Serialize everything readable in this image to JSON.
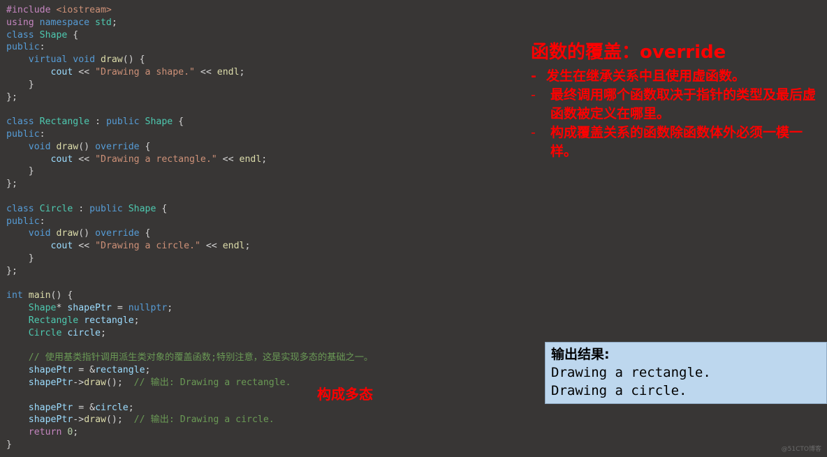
{
  "code": {
    "lines": [
      [
        [
          "t-pre",
          "#include "
        ],
        [
          "t-inc",
          "<iostream>"
        ]
      ],
      [
        [
          "t-kw2",
          "using "
        ],
        [
          "t-kw",
          "namespace "
        ],
        [
          "t-type",
          "std"
        ],
        [
          "t-pun",
          ";"
        ]
      ],
      [
        [
          "t-kw",
          "class "
        ],
        [
          "t-type",
          "Shape "
        ],
        [
          "t-pun",
          "{"
        ]
      ],
      [
        [
          "t-kw",
          "public"
        ],
        [
          "t-pun",
          ":"
        ]
      ],
      [
        [
          "t-pun",
          "    "
        ],
        [
          "t-kw",
          "virtual void "
        ],
        [
          "t-fn",
          "draw"
        ],
        [
          "t-pun",
          "() {"
        ]
      ],
      [
        [
          "t-pun",
          "        "
        ],
        [
          "t-var",
          "cout "
        ],
        [
          "t-pun",
          "<< "
        ],
        [
          "t-str",
          "\"Drawing a shape.\""
        ],
        [
          "t-pun",
          " << "
        ],
        [
          "t-fn",
          "endl"
        ],
        [
          "t-pun",
          ";"
        ]
      ],
      [
        [
          "t-pun",
          "    }"
        ]
      ],
      [
        [
          "t-pun",
          "};"
        ]
      ],
      [],
      [
        [
          "t-kw",
          "class "
        ],
        [
          "t-type",
          "Rectangle "
        ],
        [
          "t-pun",
          ": "
        ],
        [
          "t-kw",
          "public "
        ],
        [
          "t-type",
          "Shape "
        ],
        [
          "t-pun",
          "{"
        ]
      ],
      [
        [
          "t-kw",
          "public"
        ],
        [
          "t-pun",
          ":"
        ]
      ],
      [
        [
          "t-pun",
          "    "
        ],
        [
          "t-kw",
          "void "
        ],
        [
          "t-fn",
          "draw"
        ],
        [
          "t-pun",
          "() "
        ],
        [
          "t-kw",
          "override "
        ],
        [
          "t-pun",
          "{"
        ]
      ],
      [
        [
          "t-pun",
          "        "
        ],
        [
          "t-var",
          "cout "
        ],
        [
          "t-pun",
          "<< "
        ],
        [
          "t-str",
          "\"Drawing a rectangle.\""
        ],
        [
          "t-pun",
          " << "
        ],
        [
          "t-fn",
          "endl"
        ],
        [
          "t-pun",
          ";"
        ]
      ],
      [
        [
          "t-pun",
          "    }"
        ]
      ],
      [
        [
          "t-pun",
          "};"
        ]
      ],
      [],
      [
        [
          "t-kw",
          "class "
        ],
        [
          "t-type",
          "Circle "
        ],
        [
          "t-pun",
          ": "
        ],
        [
          "t-kw",
          "public "
        ],
        [
          "t-type",
          "Shape "
        ],
        [
          "t-pun",
          "{"
        ]
      ],
      [
        [
          "t-kw",
          "public"
        ],
        [
          "t-pun",
          ":"
        ]
      ],
      [
        [
          "t-pun",
          "    "
        ],
        [
          "t-kw",
          "void "
        ],
        [
          "t-fn",
          "draw"
        ],
        [
          "t-pun",
          "() "
        ],
        [
          "t-kw",
          "override "
        ],
        [
          "t-pun",
          "{"
        ]
      ],
      [
        [
          "t-pun",
          "        "
        ],
        [
          "t-var",
          "cout "
        ],
        [
          "t-pun",
          "<< "
        ],
        [
          "t-str",
          "\"Drawing a circle.\""
        ],
        [
          "t-pun",
          " << "
        ],
        [
          "t-fn",
          "endl"
        ],
        [
          "t-pun",
          ";"
        ]
      ],
      [
        [
          "t-pun",
          "    }"
        ]
      ],
      [
        [
          "t-pun",
          "};"
        ]
      ],
      [],
      [
        [
          "t-kw",
          "int "
        ],
        [
          "t-fn",
          "main"
        ],
        [
          "t-pun",
          "() {"
        ]
      ],
      [
        [
          "t-pun",
          "    "
        ],
        [
          "t-type",
          "Shape"
        ],
        [
          "t-pun",
          "* "
        ],
        [
          "t-var",
          "shapePtr "
        ],
        [
          "t-pun",
          "= "
        ],
        [
          "t-kw",
          "nullptr"
        ],
        [
          "t-pun",
          ";"
        ]
      ],
      [
        [
          "t-pun",
          "    "
        ],
        [
          "t-type",
          "Rectangle "
        ],
        [
          "t-var",
          "rectangle"
        ],
        [
          "t-pun",
          ";"
        ]
      ],
      [
        [
          "t-pun",
          "    "
        ],
        [
          "t-type",
          "Circle "
        ],
        [
          "t-var",
          "circle"
        ],
        [
          "t-pun",
          ";"
        ]
      ],
      [],
      [
        [
          "t-pun",
          "    "
        ],
        [
          "t-cmt",
          "// 使用基类指针调用派生类对象的覆盖函数;特别注意，这是实现多态的基础之一。"
        ]
      ],
      [
        [
          "t-pun",
          "    "
        ],
        [
          "t-var",
          "shapePtr "
        ],
        [
          "t-pun",
          "= &"
        ],
        [
          "t-var",
          "rectangle"
        ],
        [
          "t-pun",
          ";"
        ]
      ],
      [
        [
          "t-pun",
          "    "
        ],
        [
          "t-var",
          "shapePtr"
        ],
        [
          "t-pun",
          "->"
        ],
        [
          "t-fn",
          "draw"
        ],
        [
          "t-pun",
          "();  "
        ],
        [
          "t-cmt",
          "// 输出: Drawing a rectangle."
        ]
      ],
      [],
      [
        [
          "t-pun",
          "    "
        ],
        [
          "t-var",
          "shapePtr "
        ],
        [
          "t-pun",
          "= &"
        ],
        [
          "t-var",
          "circle"
        ],
        [
          "t-pun",
          ";"
        ]
      ],
      [
        [
          "t-pun",
          "    "
        ],
        [
          "t-var",
          "shapePtr"
        ],
        [
          "t-pun",
          "->"
        ],
        [
          "t-fn",
          "draw"
        ],
        [
          "t-pun",
          "();  "
        ],
        [
          "t-cmt",
          "// 输出: Drawing a circle."
        ]
      ],
      [
        [
          "t-pun",
          "    "
        ],
        [
          "t-kw2",
          "return "
        ],
        [
          "t-num",
          "0"
        ],
        [
          "t-pun",
          ";"
        ]
      ],
      [
        [
          "t-pun",
          "}"
        ]
      ]
    ]
  },
  "notes": {
    "title": "函数的覆盖：override",
    "items": [
      {
        "bullet": "-",
        "text": "发生在继承关系中且使用虚函数。"
      },
      {
        "bullet": "-",
        "text": "最终调用哪个函数取决于指针的类型及最后虚函数被定义在哪里。"
      },
      {
        "bullet": "-",
        "text": "构成覆盖关系的函数除函数体外必须一模一样。"
      }
    ]
  },
  "annotation": {
    "text": "构成多态"
  },
  "output": {
    "heading": "输出结果:",
    "lines": [
      "Drawing a rectangle.",
      "Drawing a circle."
    ]
  },
  "watermark": {
    "text": "@51CTO博客"
  },
  "colors": {
    "accent_red": "#ff0000",
    "output_bg": "#bdd7ee",
    "background": "#383635"
  }
}
